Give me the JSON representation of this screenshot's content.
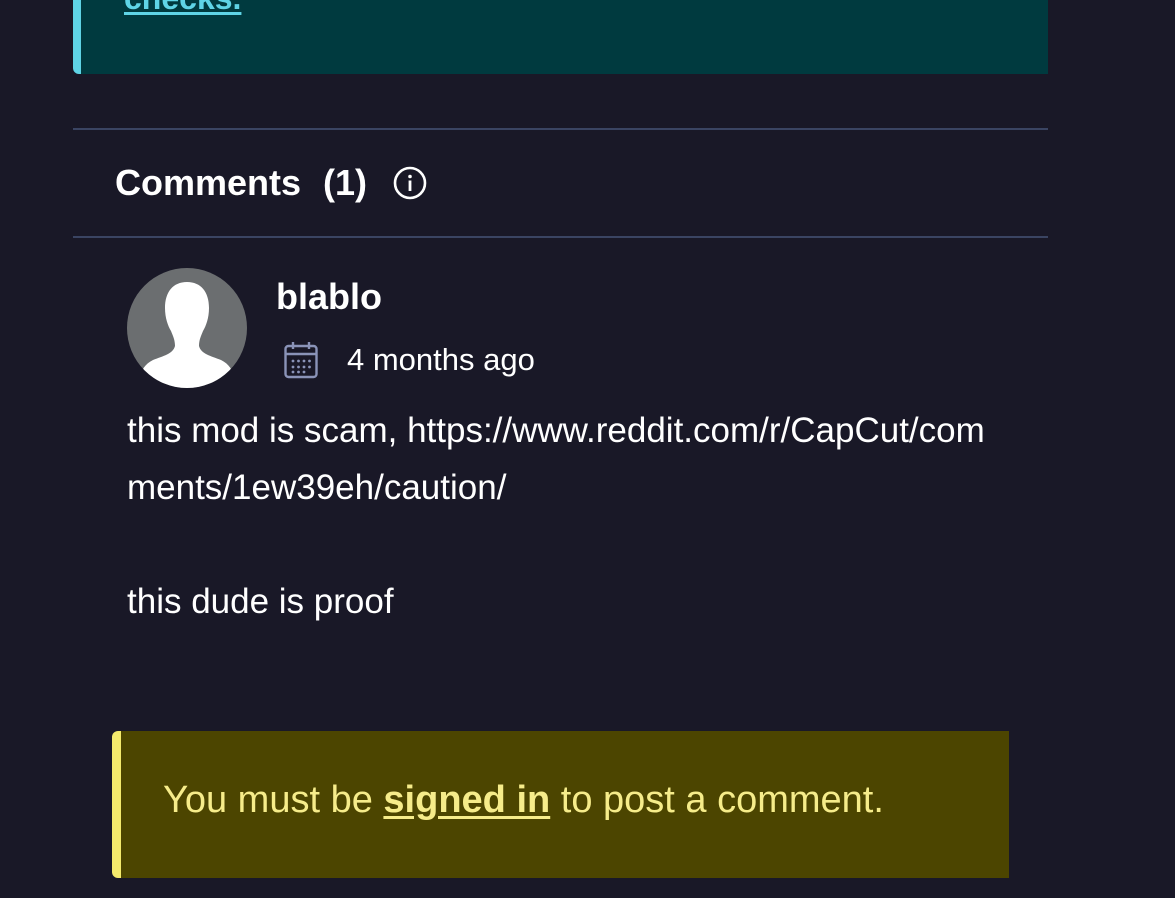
{
  "top_notice": {
    "link_text": "checks."
  },
  "comments": {
    "title": "Comments",
    "count": "(1)",
    "info_icon": "info-circle-icon"
  },
  "comment": {
    "username": "blablo",
    "time": "4 months ago",
    "calendar_icon": "calendar-icon",
    "avatar_icon": "default-user-avatar-icon",
    "body": "this mod is scam, https://www.reddit.com/r/CapCut/comments/1ew39eh/caution/\n\nthis dude is proof"
  },
  "signin_notice": {
    "prefix": "You must be ",
    "link_text": "signed in",
    "suffix": " to post a comment."
  },
  "colors": {
    "background": "#191827",
    "teal_notice_bg": "#003a3f",
    "teal_accent": "#5fd4e6",
    "divider": "#3a4462",
    "yellow_notice_bg": "#4c4500",
    "yellow_accent": "#f4ea6c"
  }
}
